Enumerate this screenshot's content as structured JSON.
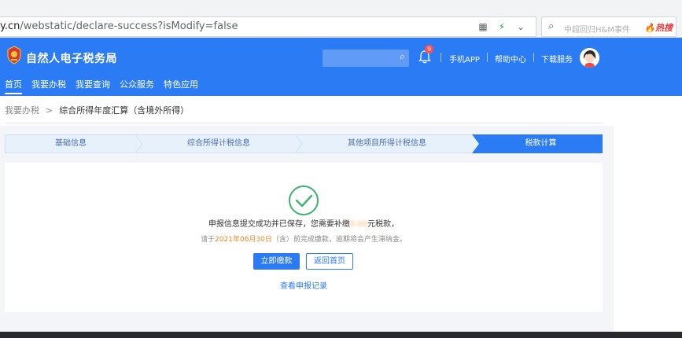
{
  "browser": {
    "url_host": "y.cn",
    "url_path": "/webstatic/declare-success?isModify=false",
    "search_hint": "中超回归H&M事件",
    "search_hot_label": "热搜"
  },
  "header": {
    "site_title": "自然人电子税务局",
    "notification_count": "9",
    "links": [
      "手机APP",
      "帮助中心",
      "下载服务"
    ],
    "brand_color": "#2b7bf5"
  },
  "nav": {
    "items": [
      "首页",
      "我要办税",
      "我要查询",
      "公众服务",
      "特色应用"
    ],
    "active_index": 0
  },
  "breadcrumb": {
    "parent": "我要办税",
    "separator": ">",
    "current": "综合所得年度汇算（含境外所得）"
  },
  "steps": {
    "items": [
      "基础信息",
      "综合所得计税信息",
      "其他项目所得计税信息",
      "税款计算"
    ],
    "active_index": 3
  },
  "result": {
    "message_before": "申报信息提交成功并已保存，您需要补缴",
    "amount_masked": "0.00",
    "message_after": "元税款，",
    "deadline_prefix": "请于",
    "deadline_date": "2021年06月30日",
    "deadline_suffix": "（含）前完成缴款，逾期将会产生滞纳金。",
    "pay_button": "立即缴款",
    "home_button": "返回首页",
    "records_link": "查看申报记录"
  }
}
